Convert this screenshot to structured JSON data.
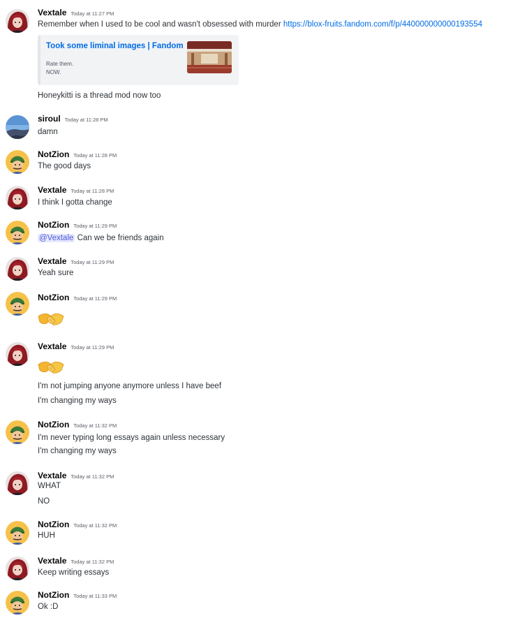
{
  "users": {
    "vextale": "Vextale",
    "siroul": "siroul",
    "notzion": "NotZion"
  },
  "colors": {
    "link": "#006ce7",
    "mention_bg": "#e6e8fd",
    "mention_text": "#505cdc"
  },
  "messages": [
    {
      "author": "Vextale",
      "timestamp": "Today at 11:27 PM",
      "avatar": "vextale-avatar",
      "text": "Remember when I used to be cool and wasn't obsessed with murder ",
      "link": "https://blox-fruits.fandom.com/f/p/440000000000193554",
      "embed": {
        "title": "Took some liminal images | Fandom",
        "desc_line1": "Rate them.",
        "desc_line2": "NOW."
      },
      "text2": "Honeykitti is a thread mod now too"
    },
    {
      "author": "siroul",
      "timestamp": "Today at 11:28 PM",
      "avatar": "siroul-avatar",
      "text": "damn"
    },
    {
      "author": "NotZion",
      "timestamp": "Today at 11:28 PM",
      "avatar": "notzion-avatar",
      "text": "The good days"
    },
    {
      "author": "Vextale",
      "timestamp": "Today at 11:28 PM",
      "avatar": "vextale-avatar",
      "text": "I think I gotta change"
    },
    {
      "author": "NotZion",
      "timestamp": "Today at 11:29 PM",
      "avatar": "notzion-avatar",
      "mention": "@Vextale",
      "text": " Can we be friends again"
    },
    {
      "author": "Vextale",
      "timestamp": "Today at 11:29 PM",
      "avatar": "vextale-avatar",
      "text": "Yeah sure"
    },
    {
      "author": "NotZion",
      "timestamp": "Today at 11:29 PM",
      "avatar": "notzion-avatar",
      "emoji": "handshake-emoji"
    },
    {
      "author": "Vextale",
      "timestamp": "Today at 11:29 PM",
      "avatar": "vextale-avatar",
      "emoji": "handshake-emoji",
      "text": "I'm not jumping anyone anymore unless I have beef",
      "text2": "I'm changing my ways"
    },
    {
      "author": "NotZion",
      "timestamp": "Today at 11:32 PM",
      "avatar": "notzion-avatar",
      "text": "I'm never typing long essays again unless necessary",
      "text2": "I'm changing my ways"
    },
    {
      "author": "Vextale",
      "timestamp": "Today at 11:32 PM",
      "avatar": "vextale-avatar",
      "text": "WHAT",
      "text2": "NO"
    },
    {
      "author": "NotZion",
      "timestamp": "Today at 11:32 PM",
      "avatar": "notzion-avatar",
      "text": "HUH"
    },
    {
      "author": "Vextale",
      "timestamp": "Today at 11:32 PM",
      "avatar": "vextale-avatar",
      "text": "Keep writing essays"
    },
    {
      "author": "NotZion",
      "timestamp": "Today at 11:33 PM",
      "avatar": "notzion-avatar",
      "text": "Ok :D"
    }
  ]
}
